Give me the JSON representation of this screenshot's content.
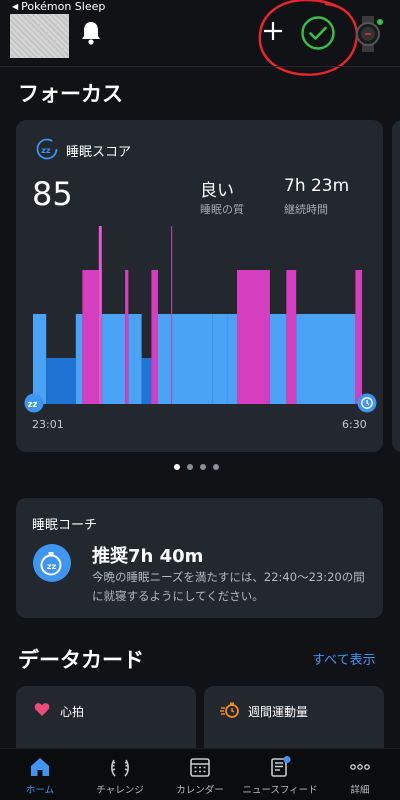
{
  "header": {
    "back_app": "Pokémon Sleep"
  },
  "focus": {
    "section_title": "フォーカス",
    "card": {
      "title": "睡眠スコア",
      "score": "85",
      "quality_value": "良い",
      "quality_label": "睡眠の質",
      "duration_value": "7h 23m",
      "duration_label": "継続時間",
      "start_time": "23:01",
      "end_time": "6:30"
    },
    "pager": {
      "count": 4,
      "active": 0
    }
  },
  "chart_data": {
    "type": "area",
    "x_start": "23:01",
    "x_end": "6:30",
    "stage_colors": {
      "awake": "#d63ec0",
      "rem": "#a83cc2",
      "light": "#4aa3f5",
      "deep": "#1f73d2"
    },
    "segments": [
      {
        "start": 0.0,
        "end": 0.04,
        "stage": "light"
      },
      {
        "start": 0.04,
        "end": 0.13,
        "stage": "deep"
      },
      {
        "start": 0.13,
        "end": 0.15,
        "stage": "light"
      },
      {
        "start": 0.15,
        "end": 0.2,
        "stage": "awake"
      },
      {
        "start": 0.2,
        "end": 0.21,
        "stage": "rem"
      },
      {
        "start": 0.21,
        "end": 0.28,
        "stage": "light"
      },
      {
        "start": 0.28,
        "end": 0.29,
        "stage": "awake"
      },
      {
        "start": 0.29,
        "end": 0.33,
        "stage": "light"
      },
      {
        "start": 0.33,
        "end": 0.36,
        "stage": "deep"
      },
      {
        "start": 0.36,
        "end": 0.38,
        "stage": "awake"
      },
      {
        "start": 0.38,
        "end": 0.42,
        "stage": "light"
      },
      {
        "start": 0.42,
        "end": 0.545,
        "stage": "light"
      },
      {
        "start": 0.545,
        "end": 0.59,
        "stage": "light"
      },
      {
        "start": 0.59,
        "end": 0.62,
        "stage": "light"
      },
      {
        "start": 0.62,
        "end": 0.72,
        "stage": "awake"
      },
      {
        "start": 0.72,
        "end": 0.77,
        "stage": "light"
      },
      {
        "start": 0.77,
        "end": 0.8,
        "stage": "awake"
      },
      {
        "start": 0.8,
        "end": 0.98,
        "stage": "light"
      },
      {
        "start": 0.98,
        "end": 1.0,
        "stage": "awake"
      }
    ]
  },
  "coach": {
    "title": "睡眠コーチ",
    "recommendation": "推奨7h 40m",
    "description": "今晩の睡眠ニーズを満たすには、22:40～23:20の間に就寝するようにしてください。"
  },
  "data_cards": {
    "section_title": "データカード",
    "show_all": "すべて表示",
    "cards": [
      {
        "label": "心拍",
        "icon": "heart-icon"
      },
      {
        "label": "週間運動量",
        "icon": "stopwatch-run-icon"
      }
    ]
  },
  "tabbar": {
    "tabs": [
      {
        "label": "ホーム",
        "icon": "home-icon",
        "active": true
      },
      {
        "label": "チャレンジ",
        "icon": "laurel-icon",
        "active": false
      },
      {
        "label": "カレンダー",
        "icon": "calendar-icon",
        "active": false
      },
      {
        "label": "ニュースフィード",
        "icon": "newsfeed-icon",
        "active": false,
        "badge": true
      },
      {
        "label": "詳細",
        "icon": "more-icon",
        "active": false
      }
    ]
  },
  "colors": {
    "accent": "#3f95f2",
    "check": "#35c24a",
    "annotation": "#e8262d"
  }
}
